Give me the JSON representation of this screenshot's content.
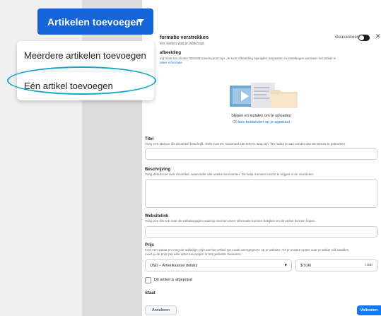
{
  "top_menu": {
    "add_button_label": "Artikelen toevoegen",
    "items": [
      {
        "label": "Meerdere artikelen toevoegen"
      },
      {
        "label": "Eén artikel toevoegen"
      }
    ]
  },
  "modal": {
    "title": "formatie verstrekken",
    "subtitle": "ers weten wat je verkoopt.",
    "advanced_label": "Geavanceerd",
    "image": {
      "label": "afbeelding",
      "hint_line1": "ing moet ten minste 500x500 pixels groot zijn. Je kunt Afbeelding bijsnijden toepassen in Instellingen wanneer het artikel is",
      "hint_line2_prefix": "",
      "hint_link": "Meer informatie",
      "drop_text": "Slepen en loslaten om te uploaden",
      "or_text": "Of",
      "choose_link": "kies bestanden op je apparaat"
    },
    "title_field": {
      "label": "Titel",
      "hint": "Voeg een titel toe die dit artikel beschrijft. Titels kunnen maximaal 150 tekens lang zijn. We raden je aan minder dan 65 tekens te gebruiken.",
      "value": ""
    },
    "description_field": {
      "label": "Beschrijving",
      "hint": "Voeg details toe over dit artikel, waaronder alle unieke kenmerken. Dit helpt mensen inzicht te krijgen in de voordelen.",
      "value": ""
    },
    "website_field": {
      "label": "Websitelink",
      "hint": "Voeg een link toe naar de websitepagina waarop mensen meer informatie kunnen bekijken en dit artikel kunnen kopen.",
      "value": ""
    },
    "price_field": {
      "label": "Prijs",
      "hint_line1": "Kies een valuta en voeg de volledige prijs van het artikel toe zoals weergegeven op je website. Als je andere opties voor je artikel wilt instellen,",
      "hint_line2": "moet je de prijs van elke optie toevoegen in het gedeelte Varianten.",
      "currency_value": "USD – Amerikaanse dollars",
      "price_value": "$ 0,00",
      "currency_suffix": "USD"
    },
    "discount_label": "Dit artikel is afgeprijsd",
    "state_label": "Staat",
    "cancel_label": "Annuleren",
    "next_label": "Voltooien"
  },
  "colors": {
    "primary": "#1877f2",
    "add_button": "#1565d8",
    "highlight_ring": "#14a6c6"
  },
  "icons": [
    "chevron-down-icon",
    "close-icon",
    "upload-illustration",
    "toggle-switch",
    "checkbox"
  ]
}
